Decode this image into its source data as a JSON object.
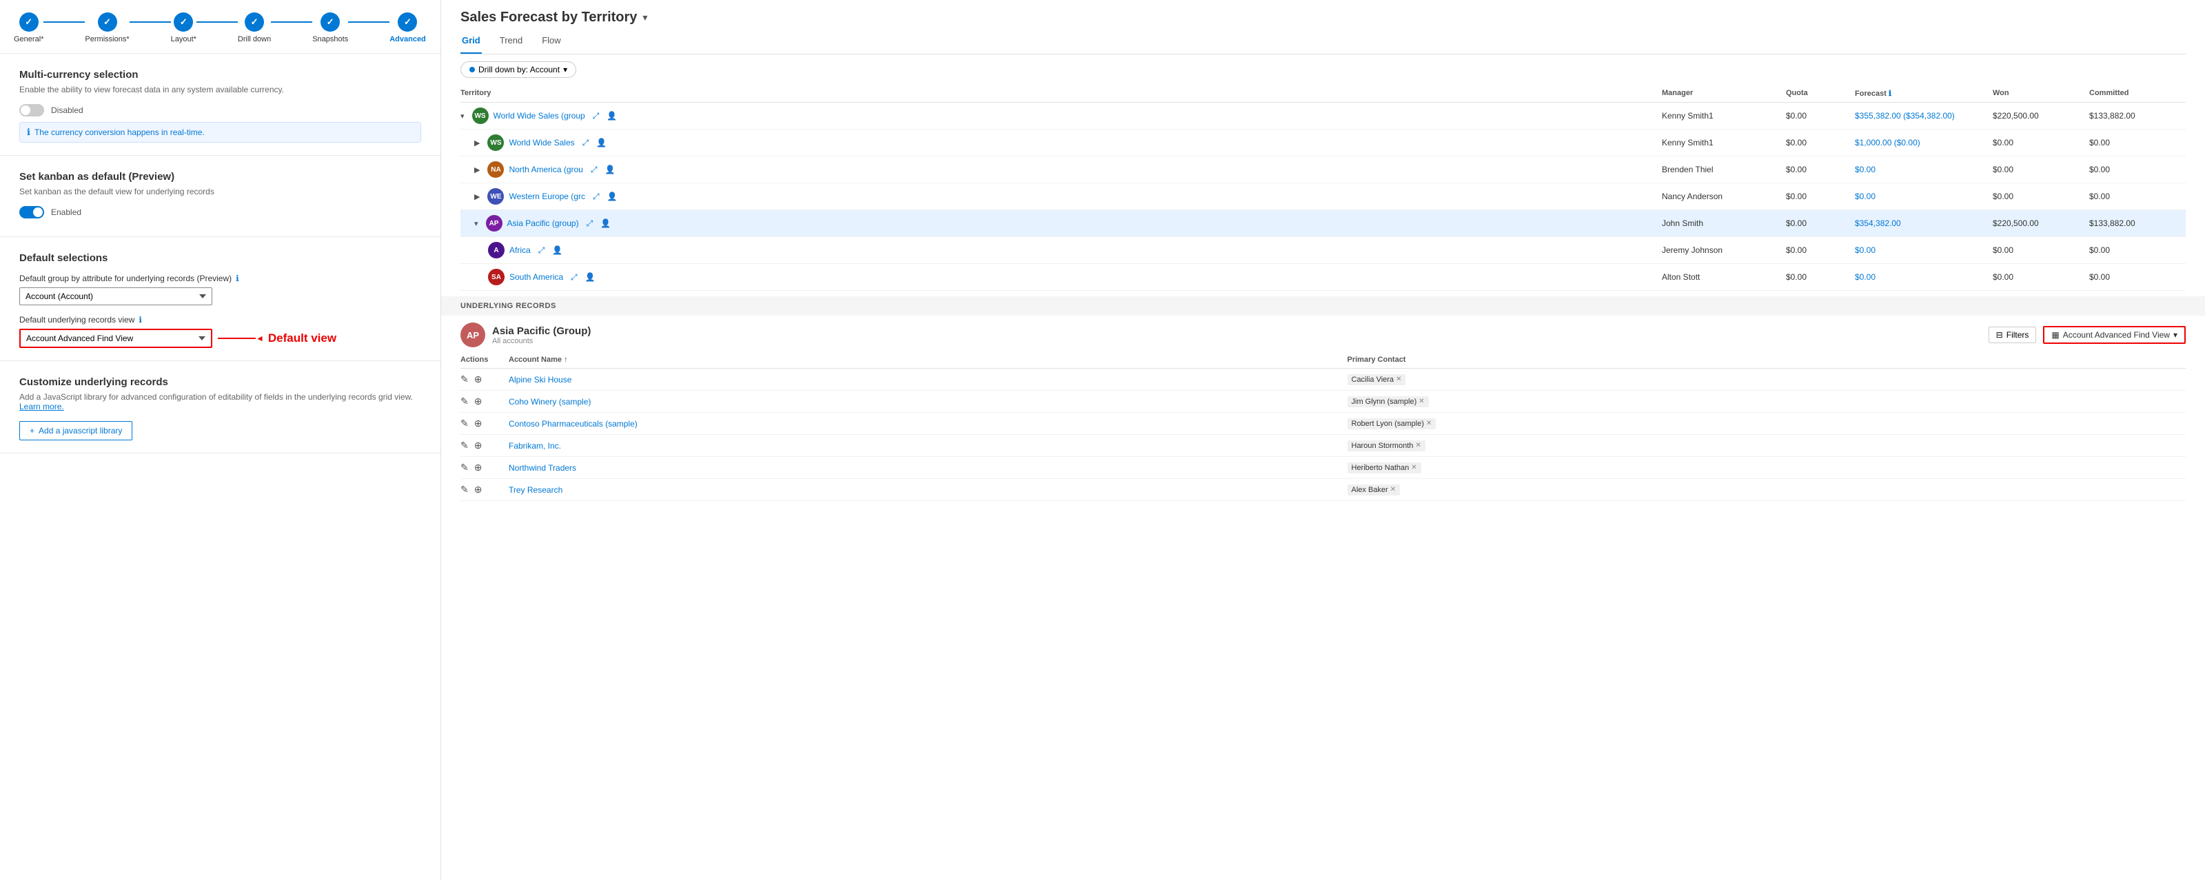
{
  "stepper": {
    "steps": [
      {
        "id": "general",
        "label": "General*",
        "active": false,
        "completed": true
      },
      {
        "id": "permissions",
        "label": "Permissions*",
        "active": false,
        "completed": true
      },
      {
        "id": "layout",
        "label": "Layout*",
        "active": false,
        "completed": true
      },
      {
        "id": "drilldown",
        "label": "Drill down",
        "active": false,
        "completed": true
      },
      {
        "id": "snapshots",
        "label": "Snapshots",
        "active": false,
        "completed": true
      },
      {
        "id": "advanced",
        "label": "Advanced",
        "active": true,
        "completed": true
      }
    ]
  },
  "multicurrency": {
    "title": "Multi-currency selection",
    "desc": "Enable the ability to view forecast data in any system available currency.",
    "toggle_state": "off",
    "toggle_label": "Disabled",
    "info_text": "The currency conversion happens in real-time."
  },
  "kanban": {
    "title": "Set kanban as default (Preview)",
    "desc": "Set kanban as the default view for underlying records",
    "toggle_state": "on",
    "toggle_label": "Enabled"
  },
  "default_selections": {
    "title": "Default selections",
    "group_label": "Default group by attribute for underlying records (Preview)",
    "group_value": "Account (Account)",
    "view_label": "Default underlying records view",
    "view_value": "Account Advanced Find View",
    "annotation_label": "Default view"
  },
  "customize": {
    "title": "Customize underlying records",
    "desc": "Add a JavaScript library for advanced configuration of editability of fields in the underlying records grid view.",
    "learn_more": "Learn more.",
    "btn_label": "+ Add a javascript library"
  },
  "forecast": {
    "title": "Sales Forecast by Territory",
    "tabs": [
      "Grid",
      "Trend",
      "Flow"
    ],
    "active_tab": "Grid",
    "drill_down_label": "Drill down by: Account",
    "table": {
      "headers": [
        "Territory",
        "Manager",
        "Quota",
        "Forecast",
        "Won",
        "Committed"
      ],
      "rows": [
        {
          "indent": 0,
          "expanded": true,
          "avatar_bg": "#2e7d32",
          "avatar_text": "WS",
          "name": "World Wide Sales (group",
          "manager": "Kenny Smith1",
          "quota": "$0.00",
          "forecast": "$355,382.00 ($354,382.00)",
          "won": "$220,500.00",
          "committed": "$133,882.00",
          "highlighted": false
        },
        {
          "indent": 1,
          "expanded": false,
          "avatar_bg": "#2e7d32",
          "avatar_text": "WS",
          "name": "World Wide Sales",
          "manager": "Kenny Smith1",
          "quota": "$0.00",
          "forecast": "$1,000.00 ($0.00)",
          "won": "$0.00",
          "committed": "$0.00",
          "highlighted": false
        },
        {
          "indent": 1,
          "expanded": false,
          "avatar_bg": "#b55c12",
          "avatar_text": "NA",
          "name": "North America (grou",
          "manager": "Brenden Thiel",
          "quota": "$0.00",
          "forecast": "$0.00",
          "won": "$0.00",
          "committed": "$0.00",
          "highlighted": false
        },
        {
          "indent": 1,
          "expanded": false,
          "avatar_bg": "#3f51b5",
          "avatar_text": "WE",
          "name": "Western Europe (grc",
          "manager": "Nancy Anderson",
          "quota": "$0.00",
          "forecast": "$0.00",
          "won": "$0.00",
          "committed": "$0.00",
          "highlighted": false
        },
        {
          "indent": 1,
          "expanded": true,
          "avatar_bg": "#7b1fa2",
          "avatar_text": "AP",
          "name": "Asia Pacific (group)",
          "manager": "John Smith",
          "quota": "$0.00",
          "forecast": "$354,382.00",
          "won": "$220,500.00",
          "committed": "$133,882.00",
          "highlighted": true
        },
        {
          "indent": 2,
          "expanded": false,
          "avatar_bg": "#4a148c",
          "avatar_text": "A",
          "name": "Africa",
          "manager": "Jeremy Johnson",
          "quota": "$0.00",
          "forecast": "$0.00",
          "won": "$0.00",
          "committed": "$0.00",
          "highlighted": false
        },
        {
          "indent": 2,
          "expanded": false,
          "avatar_bg": "#b71c1c",
          "avatar_text": "SA",
          "name": "South America",
          "manager": "Alton Stott",
          "quota": "$0.00",
          "forecast": "$0.00",
          "won": "$0.00",
          "committed": "$0.00",
          "highlighted": false
        }
      ]
    }
  },
  "underlying": {
    "section_label": "UNDERLYING RECORDS",
    "group_avatar_text": "AP",
    "group_avatar_bg": "#c25c5c",
    "group_name": "Asia Pacific (Group)",
    "group_sub": "All accounts",
    "filters_label": "Filters",
    "view_label": "Account Advanced Find View",
    "table": {
      "headers": [
        "Actions",
        "Account Name ↑",
        "Primary Contact"
      ],
      "rows": [
        {
          "name": "Alpine Ski House",
          "contact": "Cacilia Viera",
          "contact_x": true
        },
        {
          "name": "Coho Winery (sample)",
          "contact": "Jim Glynn (sample)",
          "contact_x": true
        },
        {
          "name": "Contoso Pharmaceuticals (sample)",
          "contact": "Robert Lyon (sample)",
          "contact_x": true
        },
        {
          "name": "Fabrikam, Inc.",
          "contact": "Haroun Stormonth",
          "contact_x": true
        },
        {
          "name": "Northwind Traders",
          "contact": "Heriberto Nathan",
          "contact_x": true
        },
        {
          "name": "Trey Research",
          "contact": "Alex Baker",
          "contact_x": true
        }
      ]
    }
  },
  "colors": {
    "accent": "#0078d4",
    "red": "#e00000",
    "step_active": "#0078d4"
  }
}
